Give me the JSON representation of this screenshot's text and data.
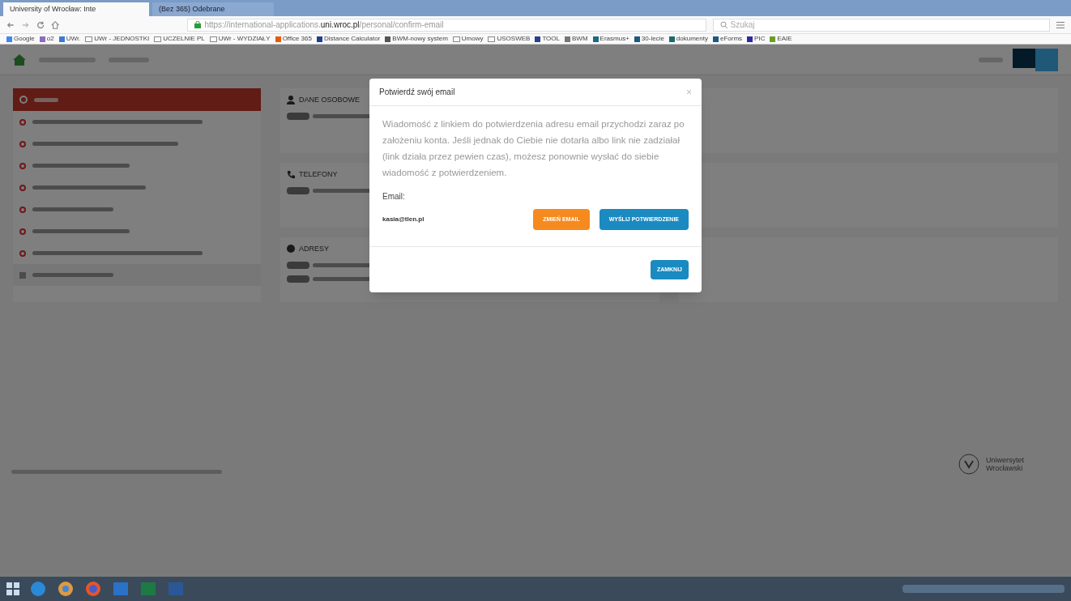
{
  "browser": {
    "tabs": [
      {
        "label": "University of Wrocław: Inte",
        "selected": true
      },
      {
        "label": "(Bez 365) Odebrane",
        "selected": false
      }
    ],
    "url": {
      "start": "https://international-applications.",
      "domain": "uni.wroc.pl",
      "path": "/personal/confirm-email"
    },
    "search": {
      "placeholder": "Szukaj"
    },
    "bookmarks": [
      {
        "label": "Google",
        "kind": "link",
        "color": "#4285f4"
      },
      {
        "label": "o2",
        "kind": "link",
        "color": "#8e6bbf"
      },
      {
        "label": "UWr.",
        "kind": "link",
        "color": "#3a7bd5"
      },
      {
        "label": "UWr - JEDNOSTKI",
        "kind": "folder",
        "color": "#8a8a8a"
      },
      {
        "label": "UCZELNIE PL",
        "kind": "folder",
        "color": "#8a8a8a"
      },
      {
        "label": "UWr - WYDZIAŁY",
        "kind": "folder",
        "color": "#8a8a8a"
      },
      {
        "label": "Office 365",
        "kind": "link",
        "color": "#e65c00"
      },
      {
        "label": "Distance Calculator",
        "kind": "link",
        "color": "#1f3f8f"
      },
      {
        "label": "BWM-nowy system",
        "kind": "link",
        "color": "#555555"
      },
      {
        "label": "Umowy",
        "kind": "folder",
        "color": "#8a8a8a"
      },
      {
        "label": "USOSWEB",
        "kind": "folder",
        "color": "#8a8a8a"
      },
      {
        "label": "TOOL",
        "kind": "link",
        "color": "#2b3f8f"
      },
      {
        "label": "BWM",
        "kind": "link",
        "color": "#777777"
      },
      {
        "label": "Erasmus+",
        "kind": "link",
        "color": "#1b6b80"
      },
      {
        "label": "30-lecie",
        "kind": "link",
        "color": "#1b5a80"
      },
      {
        "label": "dokumenty",
        "kind": "link",
        "color": "#1b6b6b"
      },
      {
        "label": "eForms",
        "kind": "link",
        "color": "#1b5a80"
      },
      {
        "label": "PIC",
        "kind": "link",
        "color": "#2a2aa0"
      },
      {
        "label": "EAIE",
        "kind": "link",
        "color": "#6aa020"
      }
    ]
  },
  "page": {
    "sidebar_items": [
      {
        "kind": "header"
      },
      {
        "kind": "todo"
      },
      {
        "kind": "todo"
      },
      {
        "kind": "todo"
      },
      {
        "kind": "todo"
      },
      {
        "kind": "todo"
      },
      {
        "kind": "todo"
      },
      {
        "kind": "todo"
      },
      {
        "kind": "done"
      }
    ],
    "language_buttons": [
      {
        "selected": true
      },
      {
        "selected": false
      }
    ],
    "sections": [
      {
        "title": "DANE OSOBOWE",
        "kind": "user",
        "rows": [
          {
            "kind": "status"
          }
        ]
      },
      {
        "title": "TELEFONY",
        "kind": "phone",
        "rows": [
          {
            "kind": "status"
          }
        ]
      },
      {
        "title": "ADRESY",
        "kind": "globe",
        "rows": [
          {
            "kind": "status"
          },
          {
            "kind": "status"
          }
        ]
      }
    ]
  },
  "modal": {
    "title": "Potwierdź swój email",
    "close": "×",
    "message": "Wiadomość z linkiem do potwierdzenia adresu email przychodzi zaraz po założeniu konta. Jeśli jednak do Ciebie nie dotarła albo link nie zadziałał (link działa przez pewien czas), możesz ponownie wysłać do siebie wiadomość z potwierdzeniem.",
    "email_label": "Email:",
    "email": "kasia@tlen.pl",
    "buttons": [
      {
        "label": "ZMIEŃ EMAIL",
        "kind": "warning"
      },
      {
        "label": "WYŚLIJ POTWIERDZENIE",
        "kind": "primary"
      }
    ],
    "close_button": "ZAMKNIJ"
  },
  "footer": {
    "logo": "Uniwersytet Wrocławski"
  }
}
